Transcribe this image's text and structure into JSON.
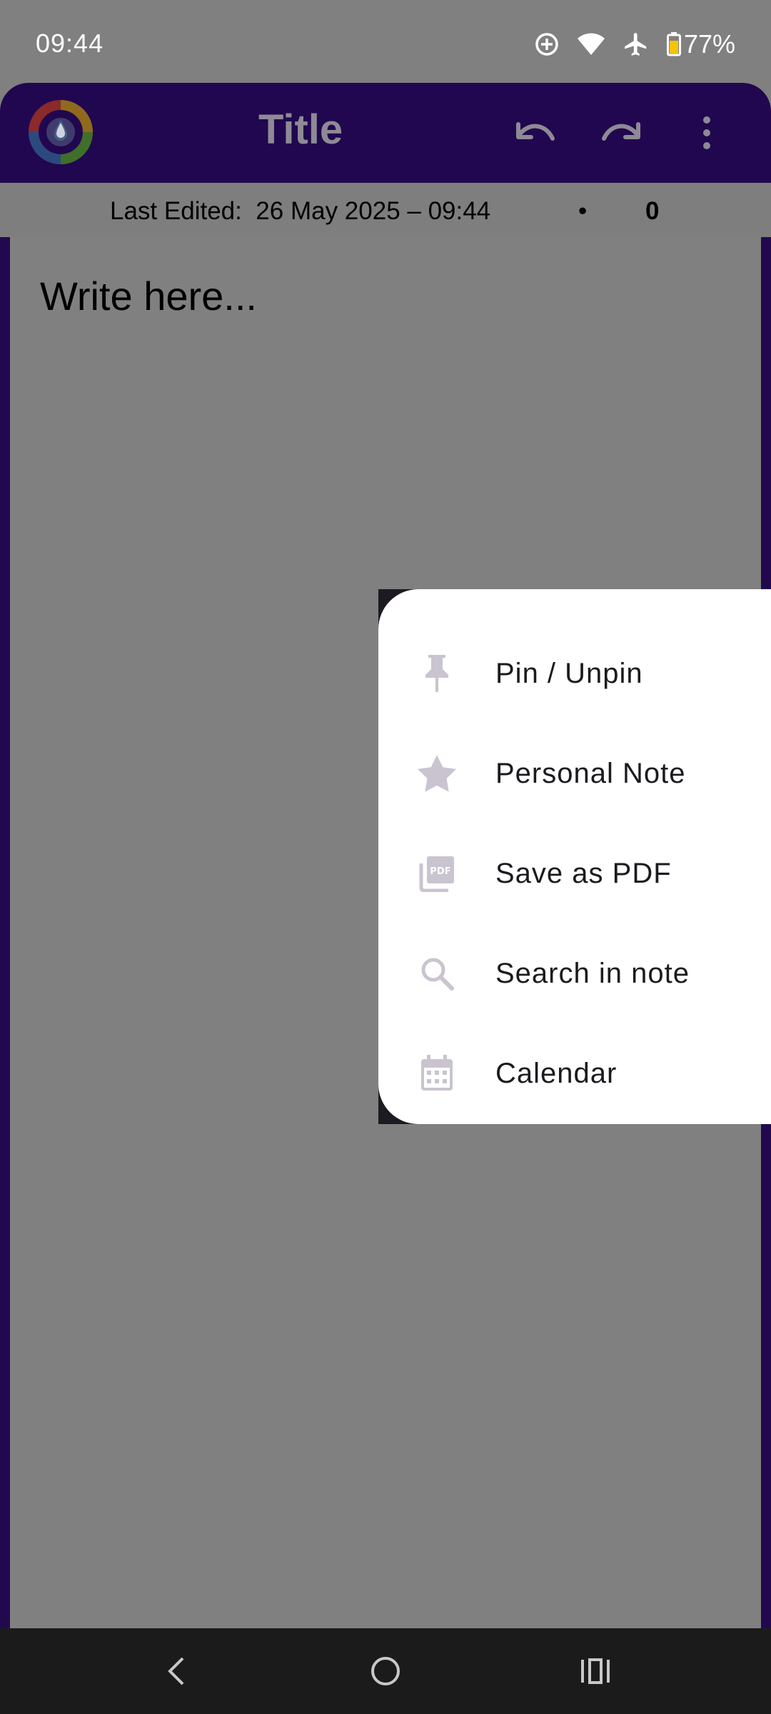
{
  "status_bar": {
    "time": "09:44",
    "battery": "77%",
    "icons": [
      "add-circle-icon",
      "wifi-icon",
      "airplane-icon",
      "battery-icon"
    ]
  },
  "app_bar": {
    "title": "Title",
    "icons": [
      "app-logo",
      "undo-icon",
      "redo-icon",
      "more-vert-icon"
    ],
    "background": "#21074f"
  },
  "sub_header": {
    "last_edited": "Last Edited:  26 May 2025 – 09:44",
    "separator": "•",
    "count": "0"
  },
  "editor": {
    "placeholder": "Write here..."
  },
  "menu": {
    "items": [
      {
        "label": "Pin / Unpin",
        "icon": "pin-icon"
      },
      {
        "label": "Personal Note",
        "icon": "star-icon"
      },
      {
        "label": "Save as PDF",
        "icon": "pdf-icon"
      },
      {
        "label": "Search in note",
        "icon": "search-icon"
      },
      {
        "label": "Calendar",
        "icon": "calendar-icon"
      }
    ],
    "icon_color": "#c9c4cf"
  },
  "nav_bar": {
    "icons": [
      "back-icon",
      "home-icon",
      "recents-icon"
    ]
  }
}
